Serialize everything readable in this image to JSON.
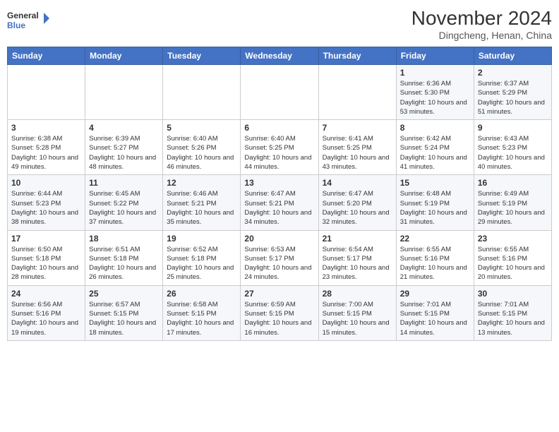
{
  "header": {
    "logo_line1": "General",
    "logo_line2": "Blue",
    "month": "November 2024",
    "location": "Dingcheng, Henan, China"
  },
  "days_of_week": [
    "Sunday",
    "Monday",
    "Tuesday",
    "Wednesday",
    "Thursday",
    "Friday",
    "Saturday"
  ],
  "weeks": [
    [
      {
        "day": "",
        "info": ""
      },
      {
        "day": "",
        "info": ""
      },
      {
        "day": "",
        "info": ""
      },
      {
        "day": "",
        "info": ""
      },
      {
        "day": "",
        "info": ""
      },
      {
        "day": "1",
        "info": "Sunrise: 6:36 AM\nSunset: 5:30 PM\nDaylight: 10 hours and 53 minutes."
      },
      {
        "day": "2",
        "info": "Sunrise: 6:37 AM\nSunset: 5:29 PM\nDaylight: 10 hours and 51 minutes."
      }
    ],
    [
      {
        "day": "3",
        "info": "Sunrise: 6:38 AM\nSunset: 5:28 PM\nDaylight: 10 hours and 49 minutes."
      },
      {
        "day": "4",
        "info": "Sunrise: 6:39 AM\nSunset: 5:27 PM\nDaylight: 10 hours and 48 minutes."
      },
      {
        "day": "5",
        "info": "Sunrise: 6:40 AM\nSunset: 5:26 PM\nDaylight: 10 hours and 46 minutes."
      },
      {
        "day": "6",
        "info": "Sunrise: 6:40 AM\nSunset: 5:25 PM\nDaylight: 10 hours and 44 minutes."
      },
      {
        "day": "7",
        "info": "Sunrise: 6:41 AM\nSunset: 5:25 PM\nDaylight: 10 hours and 43 minutes."
      },
      {
        "day": "8",
        "info": "Sunrise: 6:42 AM\nSunset: 5:24 PM\nDaylight: 10 hours and 41 minutes."
      },
      {
        "day": "9",
        "info": "Sunrise: 6:43 AM\nSunset: 5:23 PM\nDaylight: 10 hours and 40 minutes."
      }
    ],
    [
      {
        "day": "10",
        "info": "Sunrise: 6:44 AM\nSunset: 5:23 PM\nDaylight: 10 hours and 38 minutes."
      },
      {
        "day": "11",
        "info": "Sunrise: 6:45 AM\nSunset: 5:22 PM\nDaylight: 10 hours and 37 minutes."
      },
      {
        "day": "12",
        "info": "Sunrise: 6:46 AM\nSunset: 5:21 PM\nDaylight: 10 hours and 35 minutes."
      },
      {
        "day": "13",
        "info": "Sunrise: 6:47 AM\nSunset: 5:21 PM\nDaylight: 10 hours and 34 minutes."
      },
      {
        "day": "14",
        "info": "Sunrise: 6:47 AM\nSunset: 5:20 PM\nDaylight: 10 hours and 32 minutes."
      },
      {
        "day": "15",
        "info": "Sunrise: 6:48 AM\nSunset: 5:19 PM\nDaylight: 10 hours and 31 minutes."
      },
      {
        "day": "16",
        "info": "Sunrise: 6:49 AM\nSunset: 5:19 PM\nDaylight: 10 hours and 29 minutes."
      }
    ],
    [
      {
        "day": "17",
        "info": "Sunrise: 6:50 AM\nSunset: 5:18 PM\nDaylight: 10 hours and 28 minutes."
      },
      {
        "day": "18",
        "info": "Sunrise: 6:51 AM\nSunset: 5:18 PM\nDaylight: 10 hours and 26 minutes."
      },
      {
        "day": "19",
        "info": "Sunrise: 6:52 AM\nSunset: 5:18 PM\nDaylight: 10 hours and 25 minutes."
      },
      {
        "day": "20",
        "info": "Sunrise: 6:53 AM\nSunset: 5:17 PM\nDaylight: 10 hours and 24 minutes."
      },
      {
        "day": "21",
        "info": "Sunrise: 6:54 AM\nSunset: 5:17 PM\nDaylight: 10 hours and 23 minutes."
      },
      {
        "day": "22",
        "info": "Sunrise: 6:55 AM\nSunset: 5:16 PM\nDaylight: 10 hours and 21 minutes."
      },
      {
        "day": "23",
        "info": "Sunrise: 6:55 AM\nSunset: 5:16 PM\nDaylight: 10 hours and 20 minutes."
      }
    ],
    [
      {
        "day": "24",
        "info": "Sunrise: 6:56 AM\nSunset: 5:16 PM\nDaylight: 10 hours and 19 minutes."
      },
      {
        "day": "25",
        "info": "Sunrise: 6:57 AM\nSunset: 5:15 PM\nDaylight: 10 hours and 18 minutes."
      },
      {
        "day": "26",
        "info": "Sunrise: 6:58 AM\nSunset: 5:15 PM\nDaylight: 10 hours and 17 minutes."
      },
      {
        "day": "27",
        "info": "Sunrise: 6:59 AM\nSunset: 5:15 PM\nDaylight: 10 hours and 16 minutes."
      },
      {
        "day": "28",
        "info": "Sunrise: 7:00 AM\nSunset: 5:15 PM\nDaylight: 10 hours and 15 minutes."
      },
      {
        "day": "29",
        "info": "Sunrise: 7:01 AM\nSunset: 5:15 PM\nDaylight: 10 hours and 14 minutes."
      },
      {
        "day": "30",
        "info": "Sunrise: 7:01 AM\nSunset: 5:15 PM\nDaylight: 10 hours and 13 minutes."
      }
    ]
  ]
}
